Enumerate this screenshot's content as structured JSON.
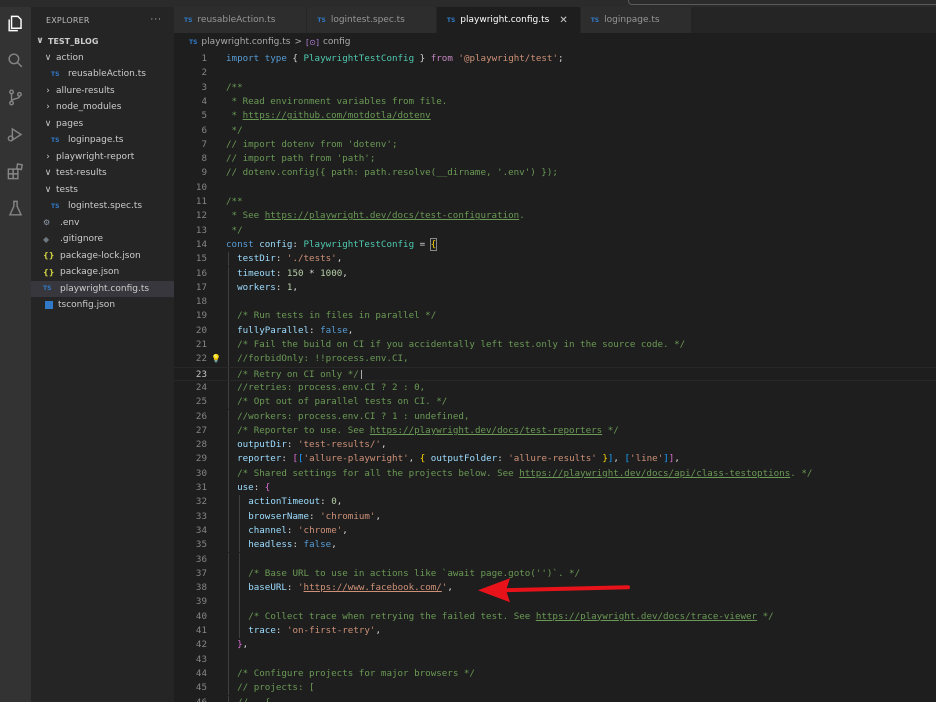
{
  "explorer": {
    "title": "EXPLORER",
    "more": "···",
    "tree": [
      {
        "label": "TEST_BLOG",
        "kind": "root",
        "chevron": "∨",
        "indent": 0
      },
      {
        "label": "action",
        "kind": "folder",
        "chevron": "∨",
        "indent": 1
      },
      {
        "label": "reusableAction.ts",
        "kind": "ts",
        "indent": 2
      },
      {
        "label": "allure-results",
        "kind": "folder",
        "chevron": "›",
        "indent": 1
      },
      {
        "label": "node_modules",
        "kind": "folder",
        "chevron": "›",
        "indent": 1
      },
      {
        "label": "pages",
        "kind": "folder",
        "chevron": "∨",
        "indent": 1
      },
      {
        "label": "loginpage.ts",
        "kind": "ts",
        "indent": 2
      },
      {
        "label": "playwright-report",
        "kind": "folder",
        "chevron": "›",
        "indent": 1
      },
      {
        "label": "test-results",
        "kind": "folder",
        "chevron": "∨",
        "indent": 1
      },
      {
        "label": "tests",
        "kind": "folder",
        "chevron": "∨",
        "indent": 1
      },
      {
        "label": "logintest.spec.ts",
        "kind": "ts",
        "indent": 2
      },
      {
        "label": ".env",
        "kind": "env",
        "indent": 1
      },
      {
        "label": ".gitignore",
        "kind": "git",
        "indent": 1
      },
      {
        "label": "package-lock.json",
        "kind": "json",
        "indent": 1
      },
      {
        "label": "package.json",
        "kind": "json",
        "indent": 1
      },
      {
        "label": "playwright.config.ts",
        "kind": "ts",
        "indent": 1,
        "selected": true
      },
      {
        "label": "tsconfig.json",
        "kind": "tscfg",
        "indent": 1
      }
    ]
  },
  "tabs": [
    {
      "label": "reusableAction.ts",
      "active": false
    },
    {
      "label": "logintest.spec.ts",
      "active": false
    },
    {
      "label": "playwright.config.ts",
      "active": true
    },
    {
      "label": "loginpage.ts",
      "active": false
    }
  ],
  "icons": {
    "ts_badge": "TS",
    "json_badge": "{}",
    "env_badge": "⚙",
    "git_badge": "◆",
    "close": "✕",
    "lightbulb": "💡"
  },
  "breadcrumb": {
    "file": "playwright.config.ts",
    "separator": ">",
    "symbol_icon": "[⊙]",
    "symbol": "config"
  },
  "editor": {
    "current_line": 23,
    "lines": [
      {
        "n": 1,
        "indent": 0,
        "t": [
          [
            "kw",
            "import "
          ],
          [
            "kw",
            "type "
          ],
          [
            "plain",
            "{ "
          ],
          [
            "type",
            "PlaywrightTestConfig"
          ],
          [
            "plain",
            " } "
          ],
          [
            "ctrl",
            "from "
          ],
          [
            "str",
            "'@playwright/test'"
          ],
          [
            "plain",
            ";"
          ]
        ]
      },
      {
        "n": 2,
        "indent": 0,
        "t": []
      },
      {
        "n": 3,
        "indent": 0,
        "t": [
          [
            "cmt",
            "/**"
          ]
        ]
      },
      {
        "n": 4,
        "indent": 0,
        "t": [
          [
            "cmt",
            " * Read environment variables from file."
          ]
        ]
      },
      {
        "n": 5,
        "indent": 0,
        "t": [
          [
            "cmt",
            " * "
          ],
          [
            "cmtlink",
            "https://github.com/motdotla/dotenv"
          ]
        ]
      },
      {
        "n": 6,
        "indent": 0,
        "t": [
          [
            "cmt",
            " */"
          ]
        ]
      },
      {
        "n": 7,
        "indent": 0,
        "t": [
          [
            "cmt",
            "// import dotenv from 'dotenv';"
          ]
        ]
      },
      {
        "n": 8,
        "indent": 0,
        "t": [
          [
            "cmt",
            "// import path from 'path';"
          ]
        ]
      },
      {
        "n": 9,
        "indent": 0,
        "t": [
          [
            "cmt",
            "// dotenv.config({ path: path.resolve(__dirname, '.env') });"
          ]
        ]
      },
      {
        "n": 10,
        "indent": 0,
        "t": []
      },
      {
        "n": 11,
        "indent": 0,
        "t": [
          [
            "cmt",
            "/**"
          ]
        ]
      },
      {
        "n": 12,
        "indent": 0,
        "t": [
          [
            "cmt",
            " * See "
          ],
          [
            "cmtlink",
            "https://playwright.dev/docs/test-configuration"
          ],
          [
            "cmt",
            "."
          ]
        ]
      },
      {
        "n": 13,
        "indent": 0,
        "t": [
          [
            "cmt",
            " */"
          ]
        ]
      },
      {
        "n": 14,
        "indent": 0,
        "t": [
          [
            "kw",
            "const "
          ],
          [
            "var",
            "config"
          ],
          [
            "plain",
            ": "
          ],
          [
            "type",
            "PlaywrightTestConfig"
          ],
          [
            "plain",
            " = "
          ],
          [
            "bracehl",
            "{"
          ]
        ]
      },
      {
        "n": 15,
        "indent": 1,
        "t": [
          [
            "var",
            "testDir"
          ],
          [
            "plain",
            ": "
          ],
          [
            "str",
            "'./tests'"
          ],
          [
            "plain",
            ","
          ]
        ]
      },
      {
        "n": 16,
        "indent": 1,
        "t": [
          [
            "var",
            "timeout"
          ],
          [
            "plain",
            ": "
          ],
          [
            "num",
            "150"
          ],
          [
            "plain",
            " * "
          ],
          [
            "num",
            "1000"
          ],
          [
            "plain",
            ","
          ]
        ]
      },
      {
        "n": 17,
        "indent": 1,
        "t": [
          [
            "var",
            "workers"
          ],
          [
            "plain",
            ": "
          ],
          [
            "num",
            "1"
          ],
          [
            "plain",
            ","
          ]
        ]
      },
      {
        "n": 18,
        "indent": 1,
        "t": []
      },
      {
        "n": 19,
        "indent": 1,
        "t": [
          [
            "cmt",
            "/* Run tests in files in parallel */"
          ]
        ]
      },
      {
        "n": 20,
        "indent": 1,
        "t": [
          [
            "var",
            "fullyParallel"
          ],
          [
            "plain",
            ": "
          ],
          [
            "kw",
            "false"
          ],
          [
            "plain",
            ","
          ]
        ]
      },
      {
        "n": 21,
        "indent": 1,
        "t": [
          [
            "cmt",
            "/* Fail the build on CI if you accidentally left test.only in the source code. */"
          ]
        ]
      },
      {
        "n": 22,
        "indent": 1,
        "bulb": true,
        "t": [
          [
            "cmt",
            "//forbidOnly: !!process.env.CI,"
          ]
        ]
      },
      {
        "n": 23,
        "indent": 1,
        "t": [
          [
            "cmt",
            "/* Retry on CI only */"
          ],
          [
            "plain",
            "|"
          ]
        ]
      },
      {
        "n": 24,
        "indent": 1,
        "t": [
          [
            "cmt",
            "//retries: process.env.CI ? 2 : 0,"
          ]
        ]
      },
      {
        "n": 25,
        "indent": 1,
        "t": [
          [
            "cmt",
            "/* Opt out of parallel tests on CI. */"
          ]
        ]
      },
      {
        "n": 26,
        "indent": 1,
        "t": [
          [
            "cmt",
            "//workers: process.env.CI ? 1 : undefined,"
          ]
        ]
      },
      {
        "n": 27,
        "indent": 1,
        "t": [
          [
            "cmt",
            "/* Reporter to use. See "
          ],
          [
            "cmtlink",
            "https://playwright.dev/docs/test-reporters"
          ],
          [
            "cmt",
            " */"
          ]
        ]
      },
      {
        "n": 28,
        "indent": 1,
        "t": [
          [
            "var",
            "outputDir"
          ],
          [
            "plain",
            ": "
          ],
          [
            "str",
            "'test-results/'"
          ],
          [
            "plain",
            ","
          ]
        ]
      },
      {
        "n": 29,
        "indent": 1,
        "t": [
          [
            "var",
            "reporter"
          ],
          [
            "plain",
            ": "
          ],
          [
            "bracket",
            "["
          ],
          [
            "bracket2",
            "["
          ],
          [
            "str",
            "'allure-playwright'"
          ],
          [
            "plain",
            ", "
          ],
          [
            "brace",
            "{ "
          ],
          [
            "var",
            "outputFolder"
          ],
          [
            "plain",
            ": "
          ],
          [
            "str",
            "'allure-results'"
          ],
          [
            "brace",
            " }"
          ],
          [
            "bracket2",
            "]"
          ],
          [
            "plain",
            ", "
          ],
          [
            "bracket2",
            "["
          ],
          [
            "str",
            "'line'"
          ],
          [
            "bracket2",
            "]"
          ],
          [
            "bracket",
            "]"
          ],
          [
            "plain",
            ","
          ]
        ]
      },
      {
        "n": 30,
        "indent": 1,
        "t": [
          [
            "cmt",
            "/* Shared settings for all the projects below. See "
          ],
          [
            "cmtlink",
            "https://playwright.dev/docs/api/class-testoptions"
          ],
          [
            "cmt",
            ". */"
          ]
        ]
      },
      {
        "n": 31,
        "indent": 1,
        "t": [
          [
            "var",
            "use"
          ],
          [
            "plain",
            ": "
          ],
          [
            "bracket",
            "{"
          ]
        ]
      },
      {
        "n": 32,
        "indent": 2,
        "t": [
          [
            "var",
            "actionTimeout"
          ],
          [
            "plain",
            ": "
          ],
          [
            "num",
            "0"
          ],
          [
            "plain",
            ","
          ]
        ]
      },
      {
        "n": 33,
        "indent": 2,
        "t": [
          [
            "var",
            "browserName"
          ],
          [
            "plain",
            ": "
          ],
          [
            "str",
            "'chromium'"
          ],
          [
            "plain",
            ","
          ]
        ]
      },
      {
        "n": 34,
        "indent": 2,
        "t": [
          [
            "var",
            "channel"
          ],
          [
            "plain",
            ": "
          ],
          [
            "str",
            "'chrome'"
          ],
          [
            "plain",
            ","
          ]
        ]
      },
      {
        "n": 35,
        "indent": 2,
        "t": [
          [
            "var",
            "headless"
          ],
          [
            "plain",
            ": "
          ],
          [
            "kw",
            "false"
          ],
          [
            "plain",
            ","
          ]
        ]
      },
      {
        "n": 36,
        "indent": 2,
        "t": []
      },
      {
        "n": 37,
        "indent": 2,
        "t": [
          [
            "cmt",
            "/* Base URL to use in actions like `await page.goto('')`. */"
          ]
        ]
      },
      {
        "n": 38,
        "indent": 2,
        "t": [
          [
            "var",
            "baseURL"
          ],
          [
            "plain",
            ": "
          ],
          [
            "str",
            "'"
          ],
          [
            "strlink",
            "https://www.facebook.com/"
          ],
          [
            "str",
            "'"
          ],
          [
            "plain",
            ","
          ]
        ]
      },
      {
        "n": 39,
        "indent": 2,
        "t": []
      },
      {
        "n": 40,
        "indent": 2,
        "t": [
          [
            "cmt",
            "/* Collect trace when retrying the failed test. See "
          ],
          [
            "cmtlink",
            "https://playwright.dev/docs/trace-viewer"
          ],
          [
            "cmt",
            " */"
          ]
        ]
      },
      {
        "n": 41,
        "indent": 2,
        "t": [
          [
            "var",
            "trace"
          ],
          [
            "plain",
            ": "
          ],
          [
            "str",
            "'on-first-retry'"
          ],
          [
            "plain",
            ","
          ]
        ]
      },
      {
        "n": 42,
        "indent": 1,
        "t": [
          [
            "bracket",
            "}"
          ],
          [
            "plain",
            ","
          ]
        ]
      },
      {
        "n": 43,
        "indent": 1,
        "t": []
      },
      {
        "n": 44,
        "indent": 1,
        "t": [
          [
            "cmt",
            "/* Configure projects for major browsers */"
          ]
        ]
      },
      {
        "n": 45,
        "indent": 1,
        "t": [
          [
            "cmt",
            "// projects: ["
          ]
        ]
      },
      {
        "n": 46,
        "indent": 1,
        "t": [
          [
            "cmt",
            "//   {"
          ]
        ]
      }
    ]
  },
  "annotation": {
    "arrow_color": "#e8121b",
    "points_to_line": 38
  }
}
